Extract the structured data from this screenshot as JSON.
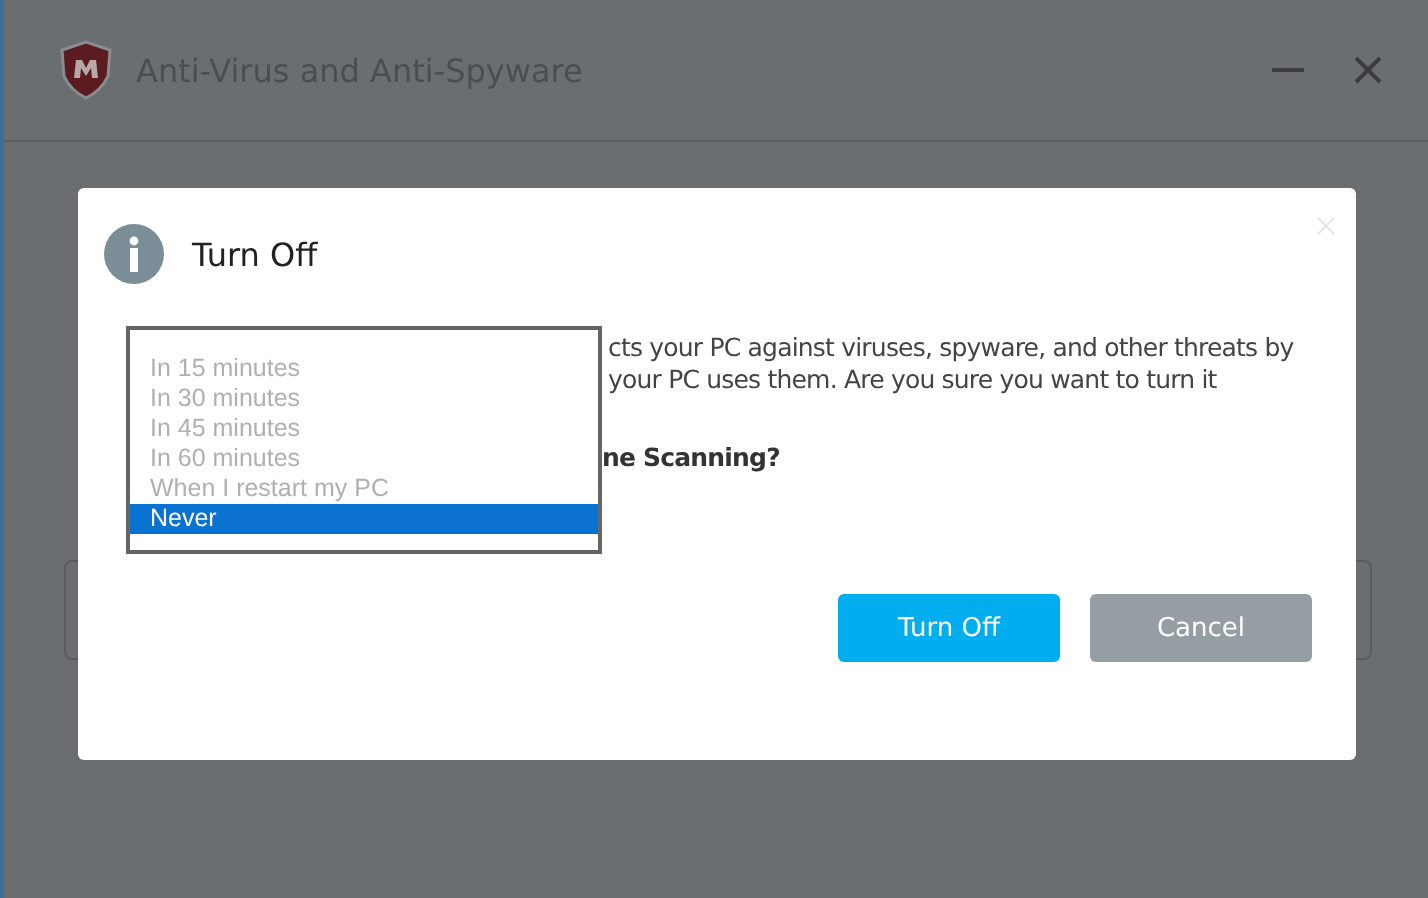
{
  "window": {
    "title": "Anti-Virus and Anti-Spyware"
  },
  "dialog": {
    "title": "Turn Off",
    "text_lines": [
      "cts your PC against viruses, spyware, and other threats by",
      "your PC uses them. Are you sure you want to turn it"
    ],
    "question": "ne Scanning?",
    "options": [
      {
        "label": "In 15 minutes",
        "selected": false
      },
      {
        "label": "In 30 minutes",
        "selected": false
      },
      {
        "label": "In 45 minutes",
        "selected": false
      },
      {
        "label": "In 60 minutes",
        "selected": false
      },
      {
        "label": "When I restart my PC",
        "selected": false
      },
      {
        "label": "Never",
        "selected": true
      }
    ],
    "buttons": [
      {
        "label": "Turn Off",
        "kind": "primary"
      },
      {
        "label": "Cancel",
        "kind": "secondary"
      }
    ]
  }
}
